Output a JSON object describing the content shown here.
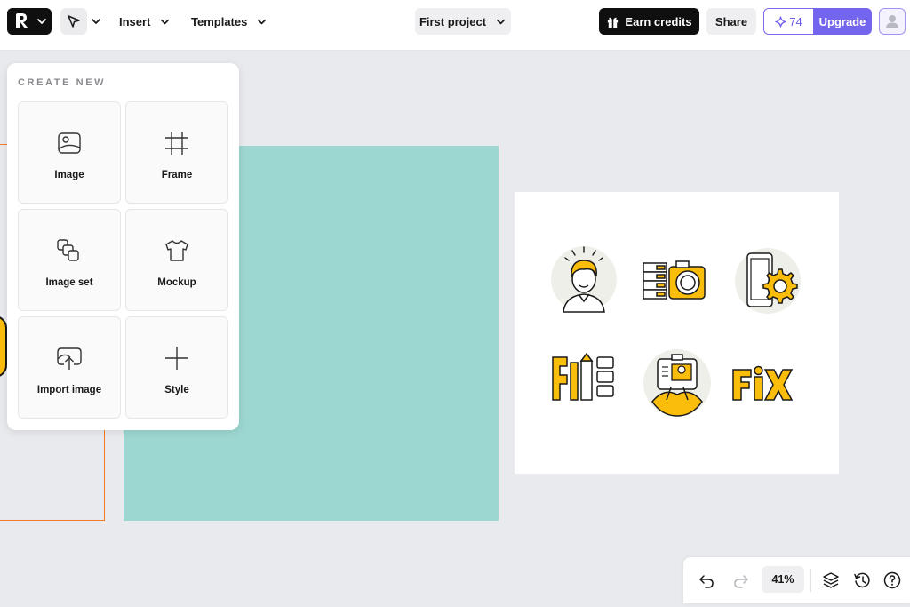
{
  "topbar": {
    "insert_label": "Insert",
    "templates_label": "Templates",
    "project_label": "First project",
    "earn_label": "Earn credits",
    "share_label": "Share",
    "credits_count": "74",
    "upgrade_label": "Upgrade"
  },
  "create_panel": {
    "title": "CREATE NEW",
    "items": [
      {
        "label": "Image",
        "icon": "image-icon"
      },
      {
        "label": "Frame",
        "icon": "frame-icon"
      },
      {
        "label": "Image set",
        "icon": "image-set-icon"
      },
      {
        "label": "Mockup",
        "icon": "tshirt-icon"
      },
      {
        "label": "Import image",
        "icon": "cloud-upload-icon"
      },
      {
        "label": "Style",
        "icon": "plus-icon"
      }
    ]
  },
  "canvas": {
    "icons_card": [
      "person-icon",
      "camera-server-icon",
      "phone-gear-icon",
      "text-pencil-icon",
      "id-card-hands-icon",
      "fix-text-icon"
    ],
    "fix_text": "FiX",
    "colors": {
      "teal": "#9dd7d1",
      "accent_yellow": "#fbbd0b",
      "orange_frame": "#f37b26"
    }
  },
  "bottom_bar": {
    "zoom": "41%"
  },
  "colors": {
    "accent": "#7465ee",
    "dark": "#0f0f0f"
  }
}
